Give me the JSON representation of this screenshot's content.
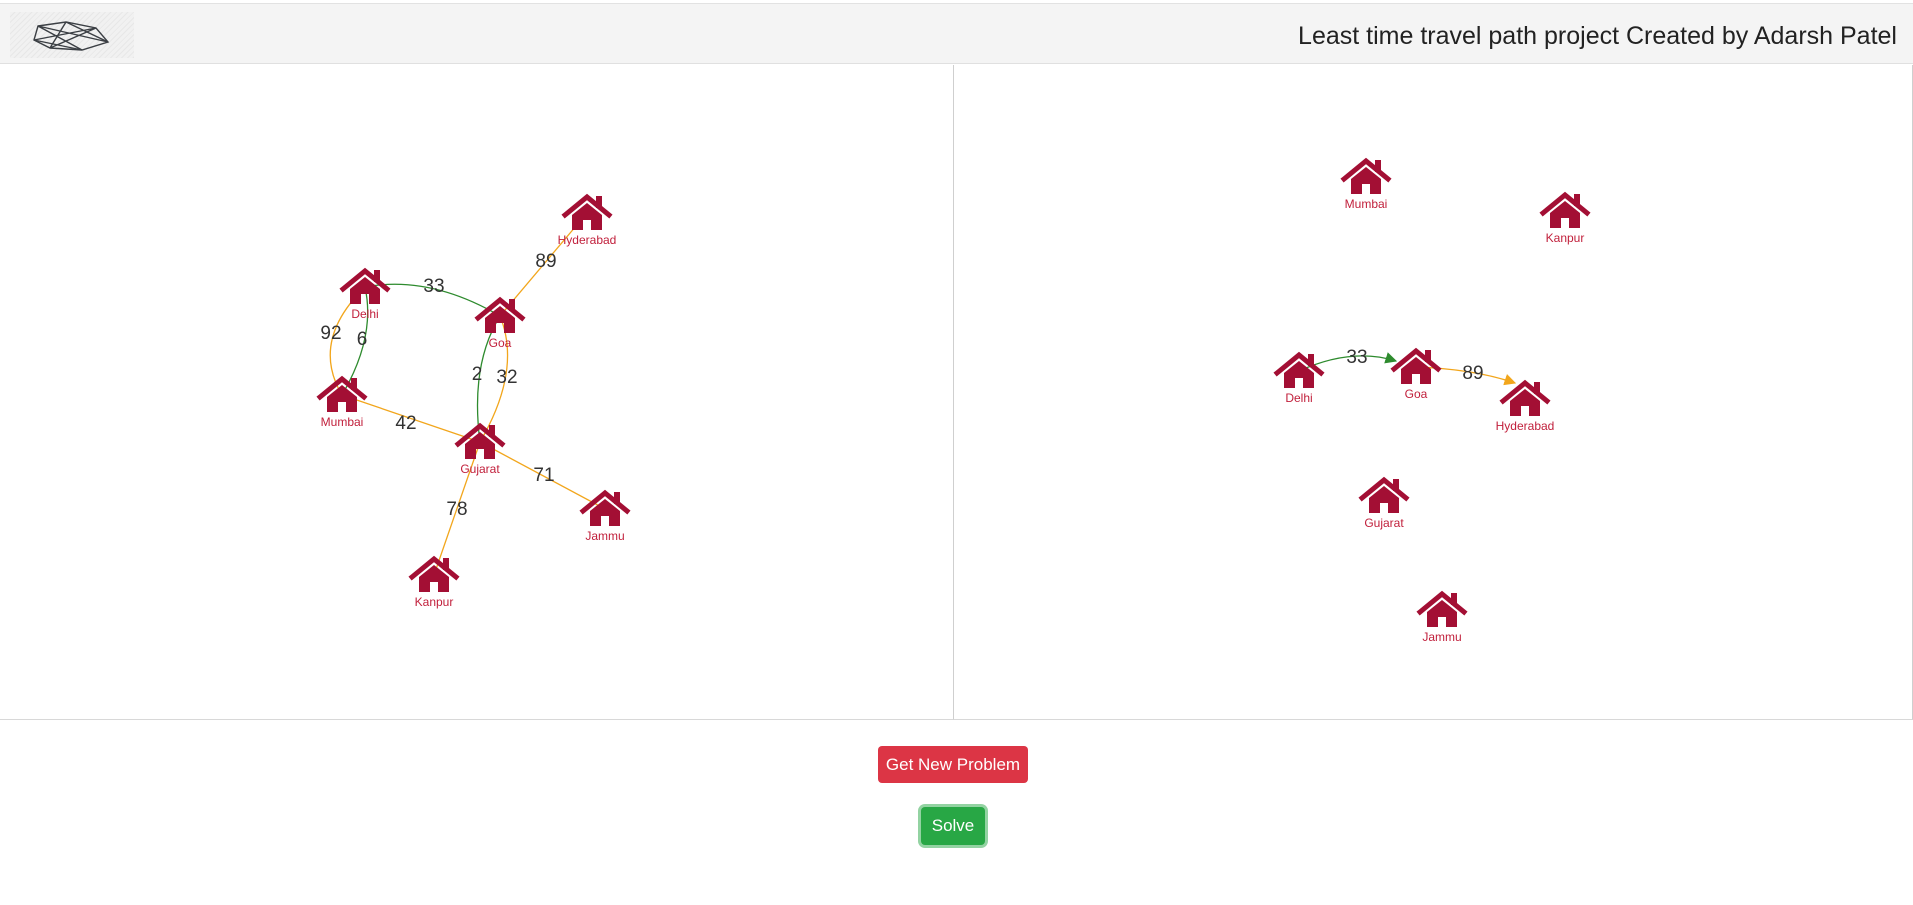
{
  "header": {
    "logo_icon": "network-graph-icon",
    "title": "Least time travel path project Created by Adarsh Patel"
  },
  "colors": {
    "node": "#a30f34",
    "node_label": "#c11f3b",
    "edge_default": "#f2a61c",
    "edge_highlight": "#2e8b2e",
    "danger": "#dc3545",
    "success": "#28a745"
  },
  "problem_graph": {
    "nodes": [
      {
        "id": "Delhi",
        "label": "Delhi",
        "icon": "house-icon"
      },
      {
        "id": "Goa",
        "label": "Goa",
        "icon": "house-icon"
      },
      {
        "id": "Hyderabad",
        "label": "Hyderabad",
        "icon": "house-icon"
      },
      {
        "id": "Mumbai",
        "label": "Mumbai",
        "icon": "house-icon"
      },
      {
        "id": "Gujarat",
        "label": "Gujarat",
        "icon": "house-icon"
      },
      {
        "id": "Jammu",
        "label": "Jammu",
        "icon": "house-icon"
      },
      {
        "id": "Kanpur",
        "label": "Kanpur",
        "icon": "house-icon"
      }
    ],
    "edges": [
      {
        "from": "Delhi",
        "to": "Goa",
        "weight": "33",
        "color": "green"
      },
      {
        "from": "Goa",
        "to": "Hyderabad",
        "weight": "89",
        "color": "orange"
      },
      {
        "from": "Delhi",
        "to": "Mumbai",
        "weight": "92",
        "color": "orange"
      },
      {
        "from": "Delhi",
        "to": "Mumbai",
        "weight": "6",
        "color": "green"
      },
      {
        "from": "Goa",
        "to": "Gujarat",
        "weight": "2",
        "color": "green"
      },
      {
        "from": "Goa",
        "to": "Gujarat",
        "weight": "32",
        "color": "orange"
      },
      {
        "from": "Mumbai",
        "to": "Gujarat",
        "weight": "42",
        "color": "orange"
      },
      {
        "from": "Gujarat",
        "to": "Jammu",
        "weight": "71",
        "color": "orange"
      },
      {
        "from": "Gujarat",
        "to": "Kanpur",
        "weight": "78",
        "color": "orange"
      }
    ]
  },
  "solution_graph": {
    "nodes": [
      {
        "id": "Mumbai",
        "label": "Mumbai",
        "icon": "house-icon"
      },
      {
        "id": "Kanpur",
        "label": "Kanpur",
        "icon": "house-icon"
      },
      {
        "id": "Delhi",
        "label": "Delhi",
        "icon": "house-icon"
      },
      {
        "id": "Goa",
        "label": "Goa",
        "icon": "house-icon"
      },
      {
        "id": "Hyderabad",
        "label": "Hyderabad",
        "icon": "house-icon"
      },
      {
        "id": "Gujarat",
        "label": "Gujarat",
        "icon": "house-icon"
      },
      {
        "id": "Jammu",
        "label": "Jammu",
        "icon": "house-icon"
      }
    ],
    "edges": [
      {
        "from": "Delhi",
        "to": "Goa",
        "weight": "33",
        "color": "green",
        "directed": true
      },
      {
        "from": "Goa",
        "to": "Hyderabad",
        "weight": "89",
        "color": "orange",
        "directed": true
      }
    ]
  },
  "actions": {
    "new_problem_label": "Get New Problem",
    "solve_label": "Solve"
  }
}
